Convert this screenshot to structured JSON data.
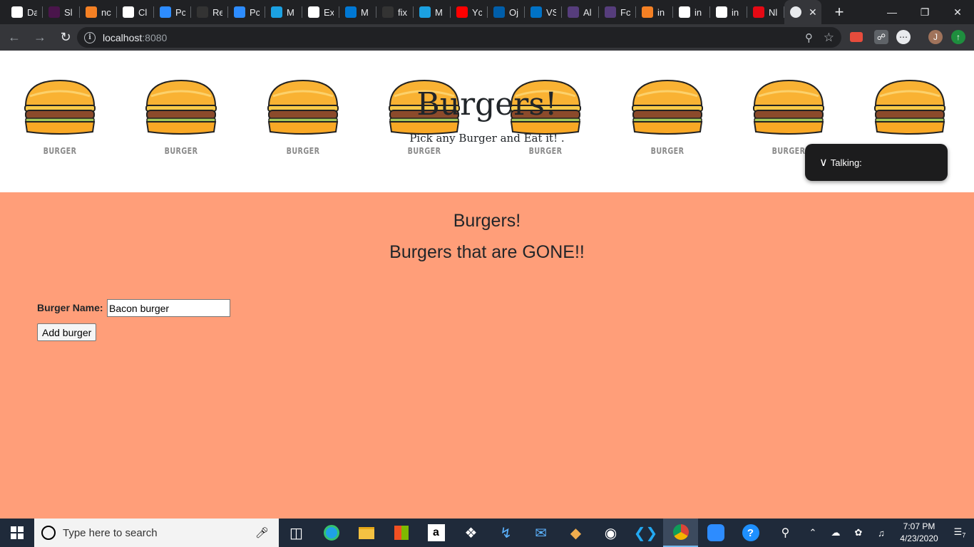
{
  "browser": {
    "tabs": [
      {
        "title": "Da",
        "icon": "github-icon",
        "color": "#ffffff"
      },
      {
        "title": "Sl",
        "icon": "slack-icon",
        "color": "#4a154b"
      },
      {
        "title": "nc",
        "icon": "stack-icon",
        "color": "#f48024"
      },
      {
        "title": "Cl",
        "icon": "camera-icon",
        "color": "#ffffff"
      },
      {
        "title": "Pc",
        "icon": "zoom-icon",
        "color": "#2d8cff"
      },
      {
        "title": "Re",
        "icon": "github-icon",
        "color": "#333333"
      },
      {
        "title": "Pc",
        "icon": "zoom-icon",
        "color": "#2d8cff"
      },
      {
        "title": "M",
        "icon": "cube-icon",
        "color": "#1ba1e2"
      },
      {
        "title": "Ex",
        "icon": "ex-icon",
        "color": "#ffffff"
      },
      {
        "title": "M",
        "icon": "outlook-icon",
        "color": "#0078d4"
      },
      {
        "title": "fix",
        "icon": "github-icon",
        "color": "#333333"
      },
      {
        "title": "M",
        "icon": "cube-icon",
        "color": "#1ba1e2"
      },
      {
        "title": "Yc",
        "icon": "youtube-icon",
        "color": "#ff0000"
      },
      {
        "title": "Oj",
        "icon": "cdc-icon",
        "color": "#005eaa"
      },
      {
        "title": "VS",
        "icon": "d-icon",
        "color": "#0072c6"
      },
      {
        "title": "Al",
        "icon": "bootstrap-icon",
        "color": "#563d7c"
      },
      {
        "title": "Fc",
        "icon": "bootstrap-icon",
        "color": "#563d7c"
      },
      {
        "title": "in",
        "icon": "stack-icon",
        "color": "#f48024"
      },
      {
        "title": "in",
        "icon": "globe-icon",
        "color": "#ffffff"
      },
      {
        "title": "in",
        "icon": "globe-icon",
        "color": "#ffffff"
      },
      {
        "title": "Nl",
        "icon": "netflix-icon",
        "color": "#e50914"
      }
    ],
    "active_tab_close": "✕",
    "new_tab": "+",
    "url_host": "localhost",
    "url_port": ":8080",
    "profile_initial": "J"
  },
  "hero": {
    "title": "Burgers!",
    "subtitle": "Pick any Burger and Eat it! .",
    "burger_label": "BURGER",
    "burger_count": 8
  },
  "talking": {
    "label": "Talking:"
  },
  "content": {
    "heading": "Burgers!",
    "subheading": "Burgers that are GONE!!",
    "form": {
      "label": "Burger Name:",
      "input_value": "Bacon burger",
      "button_label": "Add burger"
    },
    "background": "#ff9e79"
  },
  "taskbar": {
    "search_placeholder": "Type here to search",
    "time": "7:07 PM",
    "date": "4/23/2020",
    "notification_count": "7"
  }
}
